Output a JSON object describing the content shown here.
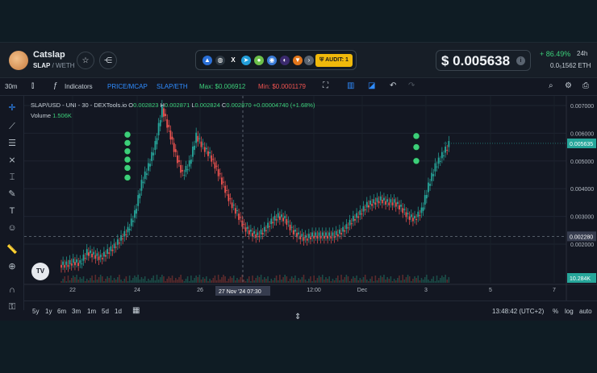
{
  "header": {
    "token_name": "Catslap",
    "token_symbol": "SLAP",
    "quote_symbol": "WETH",
    "audit_label": "AUDIT: 1",
    "price": "$ 0.005638",
    "change_24h": "+ 86.49%",
    "change_period": "24h",
    "eth_price": "0.0₅1562",
    "eth_unit": "ETH"
  },
  "toolbar": {
    "interval": "30m",
    "indicators": "Indicators",
    "price_mcap": "PRICE/MCAP",
    "pair_toggle": "SLAP/ETH",
    "max_label": "Max: $0.006912",
    "min_label": "Min: $0.0001179"
  },
  "legend": {
    "symbol": "SLAP/USD - UNI - 30 - DEXTools.io",
    "o_label": "O",
    "o_value": "0.002823",
    "h_label": "H",
    "h_value": "0.002871",
    "l_label": "L",
    "l_value": "0.002824",
    "c_label": "C",
    "c_value": "0.002870",
    "change": "+0.00004740 (+1.68%)",
    "volume_label": "Volume",
    "volume_value": "1.506K"
  },
  "crosshair": {
    "date_label": "27 Nov '24",
    "time_label": "07:30",
    "price_label": "0.002280"
  },
  "last_price_label": "0.005635",
  "volume_axis_label": "10.284K",
  "range_bar": {
    "ranges": [
      "5y",
      "1y",
      "6m",
      "3m",
      "1m",
      "5d",
      "1d"
    ],
    "clock": "13:48:42 (UTC+2)",
    "percent": "%",
    "log": "log",
    "auto": "auto"
  },
  "colors": {
    "up": "#26a69a",
    "down": "#ef5350",
    "accent_blue": "#2962ff",
    "max_green": "#3ccf7a",
    "min_red": "#ef5350",
    "marker_green": "#3ccf7a"
  },
  "icons": {
    "star": "star-icon",
    "share": "share-icon",
    "camera": "camera-icon",
    "settings": "gear-icon"
  },
  "chart_data": {
    "type": "candlestick",
    "y_ticks": [
      "0.007000",
      "0.006000",
      "0.005000",
      "0.004000",
      "0.003000",
      "0.002000"
    ],
    "x_ticks": [
      "22",
      "24",
      "26",
      "12:00",
      "Dec",
      "3",
      "5",
      "7"
    ],
    "ylim": [
      0.0001179,
      0.0072
    ],
    "series": [
      {
        "values": [
          0.00125,
          0.00135,
          0.0013,
          0.0017,
          0.0016,
          0.0015,
          0.0017,
          0.0019,
          0.0022,
          0.0025,
          0.0031,
          0.0042,
          0.0048,
          0.0056,
          0.0069,
          0.0061,
          0.0052,
          0.0045,
          0.0049,
          0.0059,
          0.0055,
          0.0052,
          0.0047,
          0.0041,
          0.0035,
          0.0031,
          0.0026,
          0.0024,
          0.0023,
          0.0025,
          0.0028,
          0.003,
          0.0029,
          0.0025,
          0.0023,
          0.0022,
          0.0023,
          0.0023,
          0.0023,
          0.0023,
          0.0024,
          0.0026,
          0.0029,
          0.0031,
          0.0034,
          0.0035,
          0.0036,
          0.0035,
          0.0035,
          0.0033,
          0.003,
          0.0029,
          0.0032,
          0.0041,
          0.0048,
          0.0052,
          0.0056
        ]
      }
    ]
  }
}
